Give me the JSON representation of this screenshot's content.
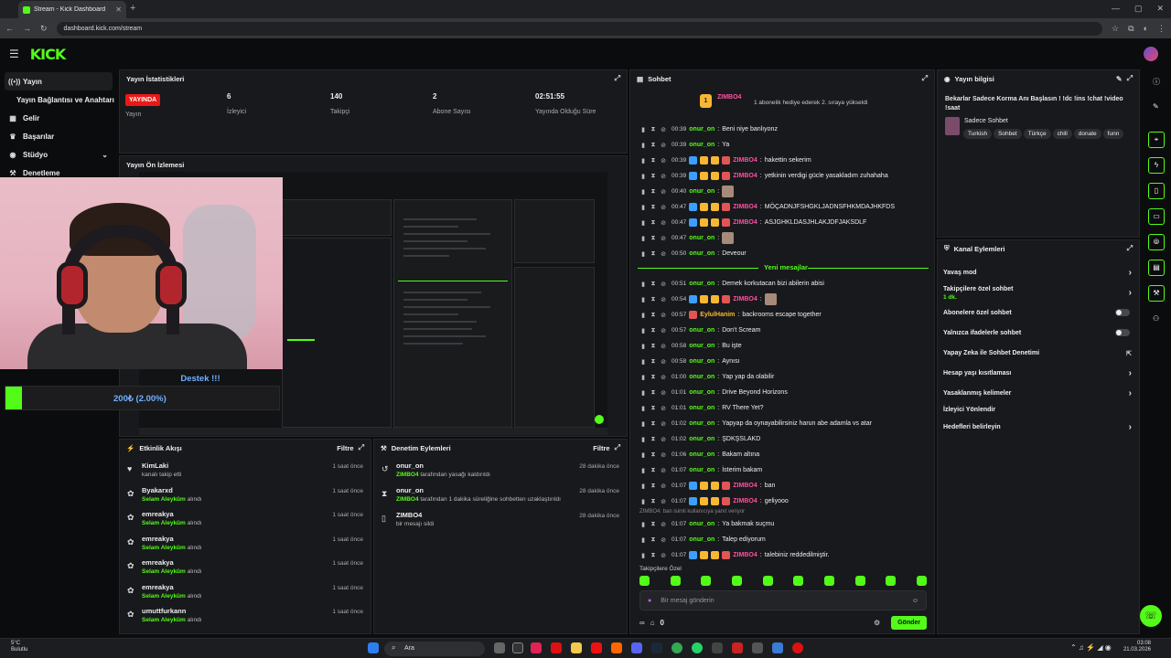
{
  "browser": {
    "tab_title": "Stream - Kick Dashboard",
    "url": "dashboard.kick.com/stream"
  },
  "header": {
    "logo": "KICK"
  },
  "nav": {
    "items": [
      "Yayın",
      "Yayın Bağlantısı ve Anahtarı",
      "Gelir",
      "Başarılar",
      "Stüdyo",
      "Denetleme"
    ]
  },
  "stats": {
    "title": "Yayın İstatistikleri",
    "live_badge": "YAYINDA",
    "live_label": "Yayın",
    "viewers": "6",
    "viewers_label": "İzleyici",
    "followers": "140",
    "followers_label": "Takipçi",
    "subs": "2",
    "subs_label": "Abone Sayısı",
    "uptime": "02:51:55",
    "uptime_label": "Yayında Olduğu Süre"
  },
  "preview": {
    "title": "Yayın Ön İzlemesi",
    "destek": "Destek !!!",
    "donation": "200₺ (2.00%)",
    "donation_progress": 0.02
  },
  "feed": {
    "title": "Etkinlik Akışı",
    "filter": "Filtre",
    "items": [
      {
        "name": "KimLaki",
        "sub": "kanalı takip etti",
        "bold": "",
        "time": "1 saat önce"
      },
      {
        "name": "Byakarxd",
        "bold": "Selam Aleyküm",
        "sub": "alındı",
        "time": "1 saat önce"
      },
      {
        "name": "emreakya",
        "bold": "Selam Aleyküm",
        "sub": "alındı",
        "time": "1 saat önce"
      },
      {
        "name": "emreakya",
        "bold": "Selam Aleyküm",
        "sub": "alındı",
        "time": "1 saat önce"
      },
      {
        "name": "emreakya",
        "bold": "Selam Aleyküm",
        "sub": "alındı",
        "time": "1 saat önce"
      },
      {
        "name": "emreakya",
        "bold": "Selam Aleyküm",
        "sub": "alındı",
        "time": "1 saat önce"
      },
      {
        "name": "umuttfurkann",
        "bold": "Selam Aleyküm",
        "sub": "alındı",
        "time": "1 saat önce"
      }
    ]
  },
  "modlog": {
    "title": "Denetim Eylemleri",
    "filter": "Filtre",
    "items": [
      {
        "name": "onur_on",
        "bold": "ZIMBO4",
        "sub": "tarafından yasağı kaldırıldı",
        "time": "28 dakika önce"
      },
      {
        "name": "onur_on",
        "bold": "ZIMBO4",
        "sub": "tarafından 1 dakika süreliğine sohbetten uzaklaştırıldı",
        "time": "28 dakika önce"
      },
      {
        "name": "ZIMBO4",
        "bold": "",
        "sub": "bir mesajı sildi",
        "time": "28 dakika önce"
      }
    ]
  },
  "chat": {
    "title": "Sohbet",
    "pinned_user": "ZIMBO4",
    "pinned_rank": "1",
    "pinned_text": "1 abonelik hediye ederek 2. sıraya yükseldi",
    "new_messages": "Yeni mesajlar",
    "messages": [
      {
        "time": "00:39",
        "user": "onur_on",
        "color": "#53fc18",
        "text": "Beni niye banlıyonz",
        "badges": 0
      },
      {
        "time": "00:39",
        "user": "onur_on",
        "color": "#53fc18",
        "text": "Ya",
        "badges": 0
      },
      {
        "time": "00:39",
        "user": "ZIMBO4",
        "color": "#ff4fa3",
        "text": "hakettin sekerim",
        "badges": 4
      },
      {
        "time": "00:39",
        "user": "ZIMBO4",
        "color": "#ff4fa3",
        "text": "yetkinin verdigi gücle yasakladım zuhahaha",
        "badges": 4
      },
      {
        "time": "00:40",
        "user": "onur_on",
        "color": "#53fc18",
        "text": "",
        "badges": 0
      },
      {
        "time": "00:47",
        "user": "ZIMBO4",
        "color": "#ff4fa3",
        "text": "MÖÇADNJFSHGKLJADNSFHKMDAJHKFDS",
        "badges": 4
      },
      {
        "time": "00:47",
        "user": "ZIMBO4",
        "color": "#ff4fa3",
        "text": "ASJGHKLDASJHLAKJDFJAKSDLF",
        "badges": 4
      },
      {
        "time": "00:47",
        "user": "onur_on",
        "color": "#53fc18",
        "text": "",
        "badges": 0
      },
      {
        "time": "00:50",
        "user": "onur_on",
        "color": "#53fc18",
        "text": "Deveour",
        "badges": 0
      },
      {
        "time": "00:51",
        "user": "onur_on",
        "color": "#53fc18",
        "text": "Demek korkutacan bizi abilerin abisi",
        "badges": 0
      },
      {
        "time": "00:54",
        "user": "ZIMBO4",
        "color": "#ff4fa3",
        "text": "",
        "badges": 4
      },
      {
        "time": "00:57",
        "user": "EylulHanim",
        "color": "#f7b733",
        "text": "backrooms escape together",
        "badges": 1
      },
      {
        "time": "00:57",
        "user": "onur_on",
        "color": "#53fc18",
        "text": "Don't Scream",
        "badges": 0
      },
      {
        "time": "00:58",
        "user": "onur_on",
        "color": "#53fc18",
        "text": "Bu işte",
        "badges": 0
      },
      {
        "time": "00:58",
        "user": "onur_on",
        "color": "#53fc18",
        "text": "Aynısı",
        "badges": 0
      },
      {
        "time": "01:00",
        "user": "onur_on",
        "color": "#53fc18",
        "text": "Yap yap da olabilir",
        "badges": 0
      },
      {
        "time": "01:01",
        "user": "onur_on",
        "color": "#53fc18",
        "text": "Drive Beyond Horizons",
        "badges": 0
      },
      {
        "time": "01:01",
        "user": "onur_on",
        "color": "#53fc18",
        "text": "RV There Yet?",
        "badges": 0
      },
      {
        "time": "01:02",
        "user": "onur_on",
        "color": "#53fc18",
        "text": "Yapyap da oynayabilirsiniz harun abe adamla vs atar",
        "badges": 0
      },
      {
        "time": "01:02",
        "user": "onur_on",
        "color": "#53fc18",
        "text": "ŞDKŞSLAKD",
        "badges": 0
      },
      {
        "time": "01:06",
        "user": "onur_on",
        "color": "#53fc18",
        "text": "Bakam altına",
        "badges": 0
      },
      {
        "time": "01:07",
        "user": "onur_on",
        "color": "#53fc18",
        "text": "İsterim bakam",
        "badges": 0
      },
      {
        "time": "01:07",
        "user": "ZIMBO4",
        "color": "#ff4fa3",
        "text": "ban",
        "badges": 4
      },
      {
        "time": "01:07",
        "user": "ZIMBO4",
        "color": "#ff4fa3",
        "text": "geliyooo",
        "badges": 4
      },
      {
        "time": "01:07",
        "user": "onur_on",
        "color": "#53fc18",
        "text": "Ya bakmak suçmu",
        "badges": 0
      },
      {
        "time": "01:07",
        "user": "onur_on",
        "color": "#53fc18",
        "text": "Talep ediyorum",
        "badges": 0
      },
      {
        "time": "01:07",
        "user": "ZIMBO4",
        "color": "#ff4fa3",
        "text": "talebiniz reddedilmiştir.",
        "badges": 4
      }
    ],
    "reply_note": "ZIMBO4: ban isimli kullanıcıya yanıt veriyor",
    "followers_only": "Takipçilere Özel",
    "input_placeholder": "Bir mesaj gönderin",
    "points": "0",
    "send": "Gönder"
  },
  "stream_info": {
    "title": "Yayın bilgisi",
    "stream_title": "Bekarlar Sadece Korma Anı Başlasın ! !dc !ins !chat !video !saat",
    "category": "Sadece Sohbet",
    "tags": [
      "Turkish",
      "Sohbet",
      "Türkçe",
      "chill",
      "donate",
      "funn"
    ]
  },
  "channel_actions": {
    "title": "Kanal Eylemleri",
    "slow_mode": "Yavaş mod",
    "followers_chat": "Takipçilere özel sohbet",
    "followers_chat_sub": "1 dk.",
    "subs_chat": "Abonelere özel sohbet",
    "emotes_only": "Yalnızca ifadelerle sohbet",
    "ai_mod": "Yapay Zeka ile Sohbet Denetimi",
    "account_age": "Hesap yaşı kısıtlaması",
    "banned_words": "Yasaklanmış kelimeler",
    "redirect": "İzleyici Yönlendir",
    "goals": "Hedefleri belirleyin"
  },
  "taskbar": {
    "temp": "5°C",
    "weather": "Bulutlu",
    "search": "Ara",
    "time": "03:08",
    "date": "21.03.2026"
  }
}
